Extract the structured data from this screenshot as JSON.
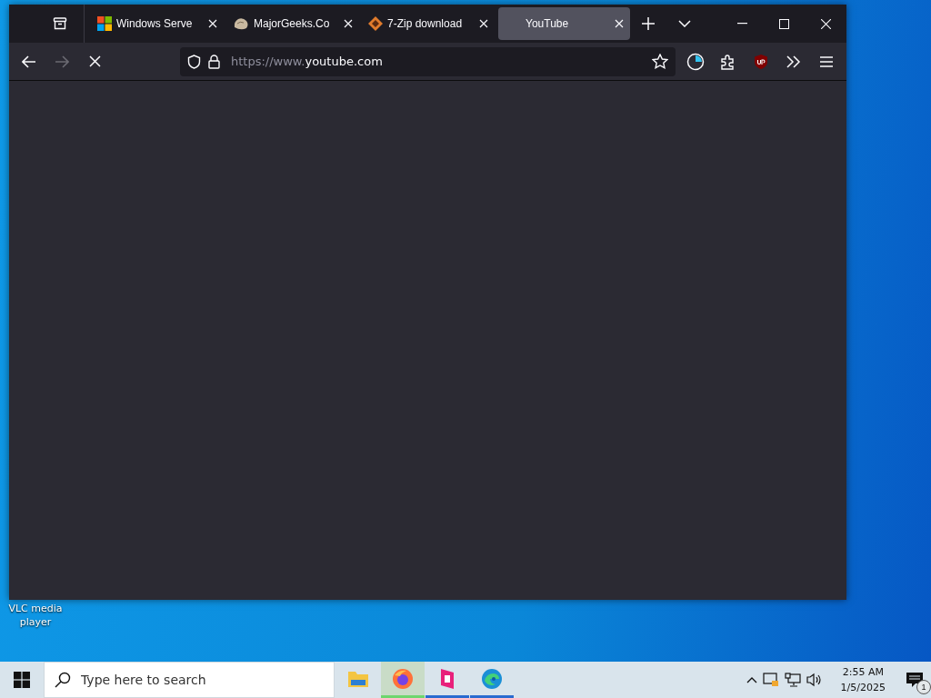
{
  "browser": {
    "tabs": [
      {
        "kind": "windows",
        "label": "Windows Serve",
        "selected": false
      },
      {
        "kind": "rock",
        "label": "MajorGeeks.Co",
        "selected": false
      },
      {
        "kind": "sevenzip",
        "label": "7-Zip download",
        "selected": false
      },
      {
        "kind": "plain",
        "label": "YouTube",
        "selected": true
      }
    ],
    "url": {
      "prefix": "https://www.",
      "domain": "youtube.com"
    },
    "forward_disabled": true,
    "loading": true
  },
  "desktop_icon": {
    "label": "VLC media player"
  },
  "taskbar": {
    "search": {
      "placeholder": "Type here to search"
    },
    "apps": [
      {
        "kind": "explorer",
        "running": false,
        "selected": false
      },
      {
        "kind": "firefox",
        "running": true,
        "selected": true
      },
      {
        "kind": "pinkapp",
        "running": true,
        "selected": false
      },
      {
        "kind": "edge",
        "running": true,
        "selected": false
      }
    ],
    "time": "2:55 AM",
    "date": "1/5/2025",
    "notification_count": "1"
  }
}
